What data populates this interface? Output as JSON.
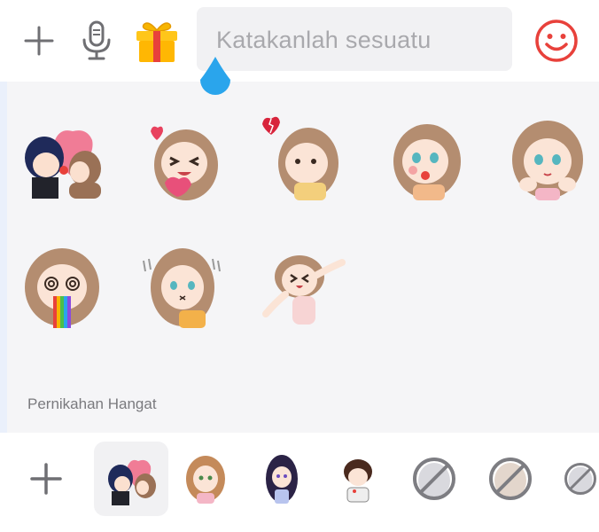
{
  "input": {
    "placeholder": "Katakanlah sesuatu"
  },
  "icons": {
    "add": "plus-icon",
    "mic": "microphone-icon",
    "gift": "gift-icon",
    "emoji": "smiley-icon",
    "tray_add": "plus-icon"
  },
  "colors": {
    "accent_red": "#e8413b",
    "drop_blue": "#2aa5ec",
    "placeholder": "#a9a9ad",
    "panel_bg": "#f5f5f7"
  },
  "stickers": [
    {
      "desc": "couple-with-heart"
    },
    {
      "desc": "girl-laughing-heart"
    },
    {
      "desc": "girl-broken-heart"
    },
    {
      "desc": "girl-puffed-cheeks"
    },
    {
      "desc": "girl-hands-on-cheeks"
    },
    {
      "desc": "girl-dizzy-rainbow"
    },
    {
      "desc": "girl-confused"
    },
    {
      "desc": "girl-stretching"
    }
  ],
  "pack": {
    "title": "Pernikahan Hangat"
  },
  "tray": {
    "items": [
      {
        "id": "pack-couple",
        "selected": true
      },
      {
        "id": "pack-brown-hair-girl",
        "selected": false
      },
      {
        "id": "pack-dark-hair-girl",
        "selected": false
      },
      {
        "id": "pack-short-hair-boy",
        "selected": false
      },
      {
        "id": "pack-unavailable-1",
        "selected": false
      },
      {
        "id": "pack-unavailable-2",
        "selected": false
      },
      {
        "id": "pack-unavailable-3",
        "selected": false
      }
    ]
  }
}
